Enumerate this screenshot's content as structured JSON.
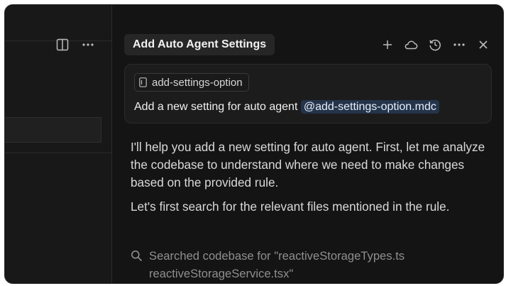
{
  "left_pane": {
    "icons": [
      "split-editor-icon",
      "more-icon"
    ]
  },
  "chat": {
    "title": "Add Auto Agent Settings",
    "header_icons": [
      "plus-icon",
      "cloud-icon",
      "history-icon",
      "more-icon",
      "close-icon"
    ],
    "prompt": {
      "context_pill": "add-settings-option",
      "text": "Add a new setting for auto agent",
      "mention": "@add-settings-option.mdc"
    },
    "response": {
      "paragraph1": "I'll help you add a new setting for auto agent. First, let me analyze the codebase to understand where we need to make changes based on the provided rule.",
      "paragraph2": "Let's first search for the relevant files mentioned in the rule."
    },
    "tool_call": {
      "text": "Searched codebase for \"reactiveStorageTypes.ts reactiveStorageService.tsx\""
    }
  }
}
